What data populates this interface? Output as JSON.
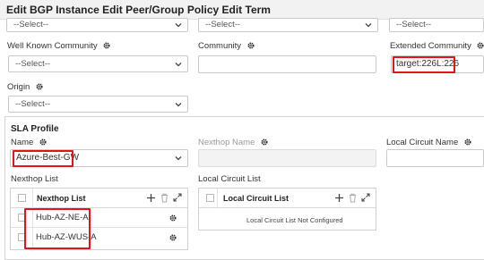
{
  "window": {
    "title": "Edit BGP Instance Edit Peer/Group Policy Edit Term"
  },
  "top_row": {
    "select_1_value": "--Select--",
    "select_2_value": "--Select--",
    "select_3_value": "--Select--"
  },
  "match_fields": {
    "well_known_community": {
      "label": "Well Known Community",
      "value": "--Select--"
    },
    "community": {
      "label": "Community",
      "value": ""
    },
    "extended_community": {
      "label": "Extended Community",
      "value": "target:226L:226"
    },
    "origin": {
      "label": "Origin",
      "value": "--Select--"
    }
  },
  "sla_profile": {
    "title": "SLA Profile",
    "name": {
      "label": "Name",
      "value": "Azure-Best-GW"
    },
    "nexthop_name": {
      "label": "Nexthop Name",
      "value": ""
    },
    "local_circuit_name": {
      "label": "Local Circuit Name",
      "value": ""
    },
    "nexthop_list": {
      "label": "Nexthop List",
      "column": "Nexthop List",
      "rows": [
        "Hub-AZ-NE-A",
        "Hub-AZ-WUS-A"
      ]
    },
    "local_circuit_list": {
      "label": "Local Circuit List",
      "column": "Local Circuit List",
      "empty_message": "Local Circuit List Not Configured"
    }
  },
  "icons": {
    "gear": "gear-icon",
    "chevron": "chevron-down-icon",
    "add": "plus-icon",
    "delete": "trash-icon",
    "expand": "expand-icon"
  },
  "colors": {
    "highlight": "#e0151b",
    "border": "#c9c9c9",
    "title_bg": "#f2f2f2"
  }
}
